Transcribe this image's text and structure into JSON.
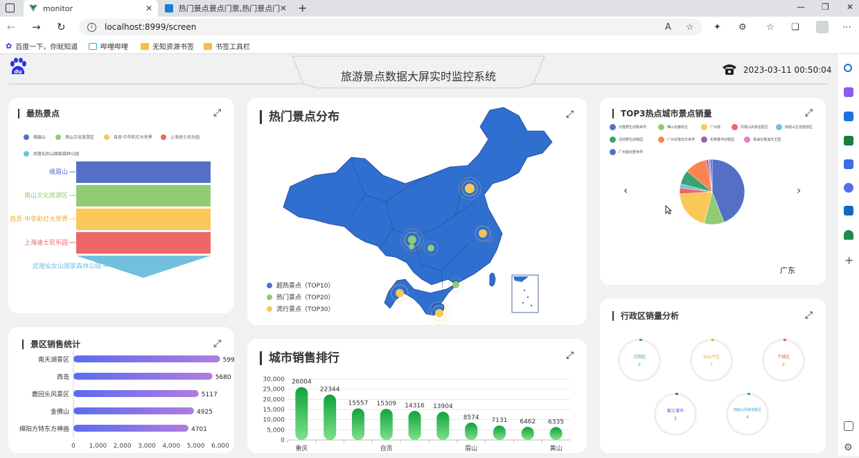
{
  "browser": {
    "tabs": [
      {
        "title": "monitor",
        "active": true
      },
      {
        "title": "热门景点景点门票,热门景点门票",
        "active": false
      }
    ],
    "url": "localhost:8999/screen",
    "bookmarks": [
      "百度一下，你就知道",
      "哔哩哔哩",
      "无知资源书签",
      "书签工具栏"
    ]
  },
  "header": {
    "title": "旅游景点数据大屏实时监控系统",
    "datetime": "2023-03-11 00:50:04",
    "logo_text": "du"
  },
  "hot_spots": {
    "title": "最热景点",
    "legend": [
      "峨眉山",
      "南山文化旅游区",
      "自贡·中华彩灯大世界",
      "上海迪士尼乐园",
      "武隆仙女山国家森林公园"
    ],
    "labels": [
      "峨眉山",
      "南山文化旅游区",
      "自贡·中华彩灯大世界",
      "上海迪士尼乐园",
      "武隆仙女山国家森林公园"
    ],
    "colors": [
      "#5470c6",
      "#91cc75",
      "#fac858",
      "#ee6666",
      "#73c0de"
    ]
  },
  "map": {
    "title": "热门景点分布",
    "legend": [
      "超热景点（TOP10）",
      "热门景点（TOP20）",
      "流行景点（TOP30）"
    ],
    "legend_colors": [
      "#5470c6",
      "#91cc75",
      "#fac858"
    ]
  },
  "top3": {
    "title": "TOP3热点城市景点销量",
    "legend": [
      "长隆野生动物世界",
      "佛山长鹿农庄",
      "广州塔",
      "丹霞山风景名胜区",
      "南昆山生态旅游区",
      "深圳野生动物园",
      "广州长隆欢乐世界",
      "东莞香市动物园",
      "珠海长隆海洋王国",
      "广州融创雪世界"
    ],
    "colors": [
      "#5470c6",
      "#91cc75",
      "#fac858",
      "#ee6666",
      "#73c0de",
      "#3ba272",
      "#fc8452",
      "#9a60b4",
      "#ea7ccc",
      "#5470c6"
    ],
    "city": "广东",
    "prev": "‹",
    "next": "›"
  },
  "district": {
    "title": "行政区销量分析",
    "rings": [
      {
        "name": "江阳区",
        "value": "2",
        "color": "#3ba272"
      },
      {
        "name": "仙山子区",
        "value": "2",
        "color": "#e6b422"
      },
      {
        "name": "下城区",
        "value": "2",
        "color": "#e36b3d"
      },
      {
        "name": "都江堰市",
        "value": "2",
        "color": "#5b5bd6"
      },
      {
        "name": "四姑山风景名胜区",
        "value": "4",
        "color": "#2aa6c7"
      }
    ]
  },
  "sales": {
    "title": "景区销售统计"
  },
  "city_rank": {
    "title": "城市销售排行"
  },
  "chart_data": [
    {
      "type": "bar",
      "orientation": "horizontal",
      "title": "景区销售统计",
      "categories": [
        "南天湖景区",
        "西岛",
        "鹿回头风景区",
        "金佛山",
        "绵阳方特东方神画"
      ],
      "values": [
        5990,
        5680,
        5117,
        4925,
        4701
      ],
      "value_labels": [
        "599",
        "5680",
        "5117",
        "4925",
        "4701"
      ],
      "xlim": [
        0,
        6000
      ],
      "xticks": [
        "0",
        "1,000",
        "2,000",
        "3,000",
        "4,000",
        "5,000",
        "6,000"
      ],
      "colors": [
        "#5b6cf0",
        "#b07de0"
      ]
    },
    {
      "type": "bar",
      "title": "城市销售排行",
      "categories": [
        "重庆",
        "",
        "",
        "自贡",
        "",
        "",
        "眉山",
        "",
        "",
        "黄山"
      ],
      "values": [
        26004,
        22344,
        15557,
        15309,
        14316,
        13904,
        8574,
        7131,
        6462,
        6335
      ],
      "ylim": [
        0,
        30000
      ],
      "yticks": [
        "0",
        "5,000",
        "10,000",
        "15,000",
        "20,000",
        "25,000",
        "30,000"
      ],
      "colors": [
        "#0fa33d",
        "#7ee08a"
      ]
    },
    {
      "type": "pie",
      "title": "TOP3热点城市景点销量",
      "labels": [
        "长隆野生动物世界",
        "佛山长鹿农庄",
        "广州塔",
        "丹霞山风景名胜区",
        "南昆山生态旅游区",
        "深圳野生动物园",
        "广州长隆欢乐世界",
        "东莞香市动物园",
        "珠海长隆海洋王国",
        "广州融创雪世界"
      ],
      "values": [
        44,
        10,
        20,
        3,
        2,
        7,
        11,
        1,
        1,
        1
      ]
    }
  ]
}
